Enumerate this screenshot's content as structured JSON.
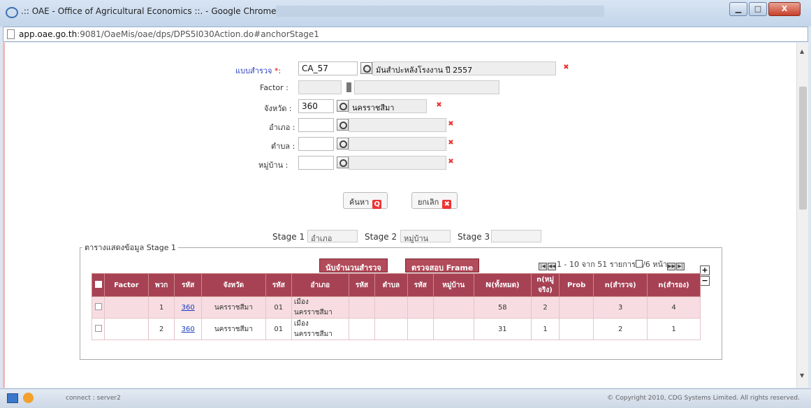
{
  "window": {
    "title": ".:: OAE - Office of Agricultural Economics ::. - Google Chrome",
    "btn_min": "▁",
    "btn_max": "□",
    "btn_close": "X"
  },
  "address": {
    "host": "app.oae.go.th",
    "path": ":9081/OaeMis/oae/dps/DPS5I030Action.do#anchorStage1"
  },
  "form": {
    "survey_label": "แบบสำรวจ",
    "survey_required": "*:",
    "survey_code": "CA_57",
    "survey_name": "มันสำปะหลังโรงงาน ปี 2557",
    "factor_label": "Factor :",
    "province_label": "จังหวัด :",
    "province_code": "360",
    "province_name": "นครราชสีมา",
    "district_label": "อำเภอ :",
    "subdistrict_label": "ตำบล :",
    "village_label": "หมู่บ้าน :",
    "clear_symbol": "✖"
  },
  "buttons": {
    "search": "ค้นหา",
    "search_icon": "Q",
    "cancel": "ยกเลิก",
    "cancel_icon": "✖",
    "count_survey": "นับจำนวนสำรวจ",
    "check_frame": "ตรวจสอบ Frame"
  },
  "stages": {
    "stage1_label": "Stage 1",
    "stage1_value": "อำเภอ",
    "stage2_label": "Stage 2",
    "stage2_value": "หมู่บ้าน",
    "stage3_label": "Stage 3",
    "stage3_value": ""
  },
  "table_section": {
    "legend": "ตารางแสดงข้อมูล Stage 1",
    "pager_text": "1 - 10 จาก 51 รายการ",
    "pager_pages": "/6 หน้า",
    "columns": [
      "Factor",
      "พวก",
      "รหัส",
      "จังหวัด",
      "รหัส",
      "อำเภอ",
      "รหัส",
      "ตำบล",
      "รหัส",
      "หมู่บ้าน",
      "N(ทั้งหมด)",
      "n(หมู่ จริง)",
      "Prob",
      "n(สำรวจ)",
      "n(สำรอง)"
    ],
    "rows": [
      {
        "factor": "",
        "group": "1",
        "prov_code": "360",
        "province": "นครราชสีมา",
        "dist_code": "01",
        "district": "เมือง นครราชสีมา",
        "sub_code": "",
        "subdistrict": "",
        "vil_code": "",
        "village": "",
        "n_total": "58",
        "n_real": "2",
        "prob": "",
        "n_survey": "3",
        "n_reserve": "4"
      },
      {
        "factor": "",
        "group": "2",
        "prov_code": "360",
        "province": "นครราชสีมา",
        "dist_code": "01",
        "district": "เมือง นครราชสีมา",
        "sub_code": "",
        "subdistrict": "",
        "vil_code": "",
        "village": "",
        "n_total": "31",
        "n_real": "1",
        "prob": "",
        "n_survey": "2",
        "n_reserve": "1"
      }
    ]
  },
  "status": {
    "left": "connect : server2",
    "right": "© Copyright 2010, CDG Systems Limited. All rights reserved."
  },
  "icons": [
    "chrome-icon",
    "page-icon",
    "lookup-icon",
    "clear-icon",
    "search-icon",
    "cancel-icon",
    "pager-first-icon",
    "pager-prev-icon",
    "pager-next-icon",
    "pager-last-icon",
    "add-row-icon",
    "remove-row-icon",
    "keyboard-icon",
    "chat-icon"
  ]
}
